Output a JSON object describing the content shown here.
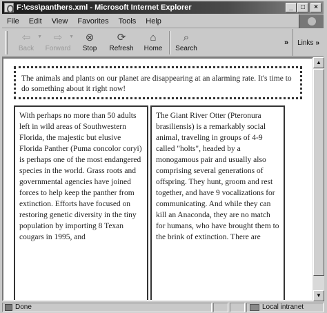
{
  "window": {
    "title": "F:\\css\\panthers.xml - Microsoft Internet Explorer",
    "controls": {
      "minimize": "_",
      "maximize": "□",
      "close": "×"
    }
  },
  "menu": [
    "File",
    "Edit",
    "View",
    "Favorites",
    "Tools",
    "Help"
  ],
  "toolbar": {
    "back": {
      "label": "Back",
      "icon": "back-arrow"
    },
    "forward": {
      "label": "Forward",
      "icon": "forward-arrow"
    },
    "stop": {
      "label": "Stop",
      "icon": "stop"
    },
    "refresh": {
      "label": "Refresh",
      "icon": "refresh"
    },
    "home": {
      "label": "Home",
      "icon": "home"
    },
    "search": {
      "label": "Search",
      "icon": "search"
    },
    "chevron": "»",
    "links": "Links",
    "links_chevron": "»"
  },
  "document": {
    "intro": "The animals and plants on our planet are disappearing at an alarming rate. It's time to do something about it right now!",
    "left_column": "With perhaps no more than 50 adults left in wild areas of Southwestern Florida, the majestic but elusive Florida Panther (Puma concolor coryi) is perhaps one of the most endangered species in the world. Grass roots and governmental agencies have joined forces to help keep the panther from extinction. Efforts have focused on restoring genetic diversity in the tiny population by importing 8 Texan cougars in 1995, and",
    "right_column": "The Giant River Otter (Pteronura brasiliensis) is a remarkably social animal, traveling in groups of 4-9 called \"holts\", headed by a monogamous pair and usually also comprising several generations of offspring. They hunt, groom and rest together, and have 9 vocalizations for communicating. And while they can kill an Anaconda, they are no match for humans, who have brought them to the brink of extinction. There are"
  },
  "status": {
    "text": "Done",
    "zone": "Local intranet"
  }
}
